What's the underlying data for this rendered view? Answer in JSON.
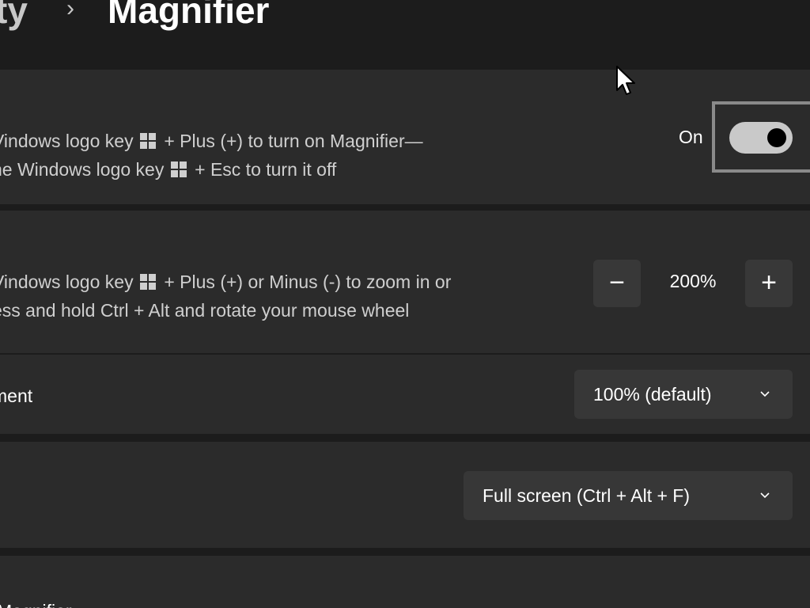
{
  "breadcrumb": {
    "parent": "ty",
    "separator": "›",
    "current": "Magnifier"
  },
  "magnifier_toggle": {
    "line1_a": "Vindows logo key",
    "line1_b": "+ Plus (+) to turn on Magnifier—",
    "line2_a": "he Windows logo key",
    "line2_b": "+ Esc to turn it off",
    "state_label": "On",
    "is_on": true
  },
  "zoom_level": {
    "line1_a": "Vindows logo key",
    "line1_b": "+ Plus (+) or Minus (-) to zoom in or",
    "line2": "ess and hold Ctrl + Alt and rotate your mouse wheel",
    "minus_label": "−",
    "plus_label": "+",
    "value": "200%"
  },
  "zoom_increment": {
    "label": "ment",
    "selected": "100% (default)"
  },
  "view": {
    "selected": "Full screen (Ctrl + Alt + F)"
  },
  "bottom_row": {
    "label": "Magnifier"
  },
  "colors": {
    "background": "#1c1c1c",
    "card": "#2b2b2b",
    "control": "#373737",
    "toggle_track": "#c9c9c9",
    "text_secondary": "#cfcfcf"
  }
}
